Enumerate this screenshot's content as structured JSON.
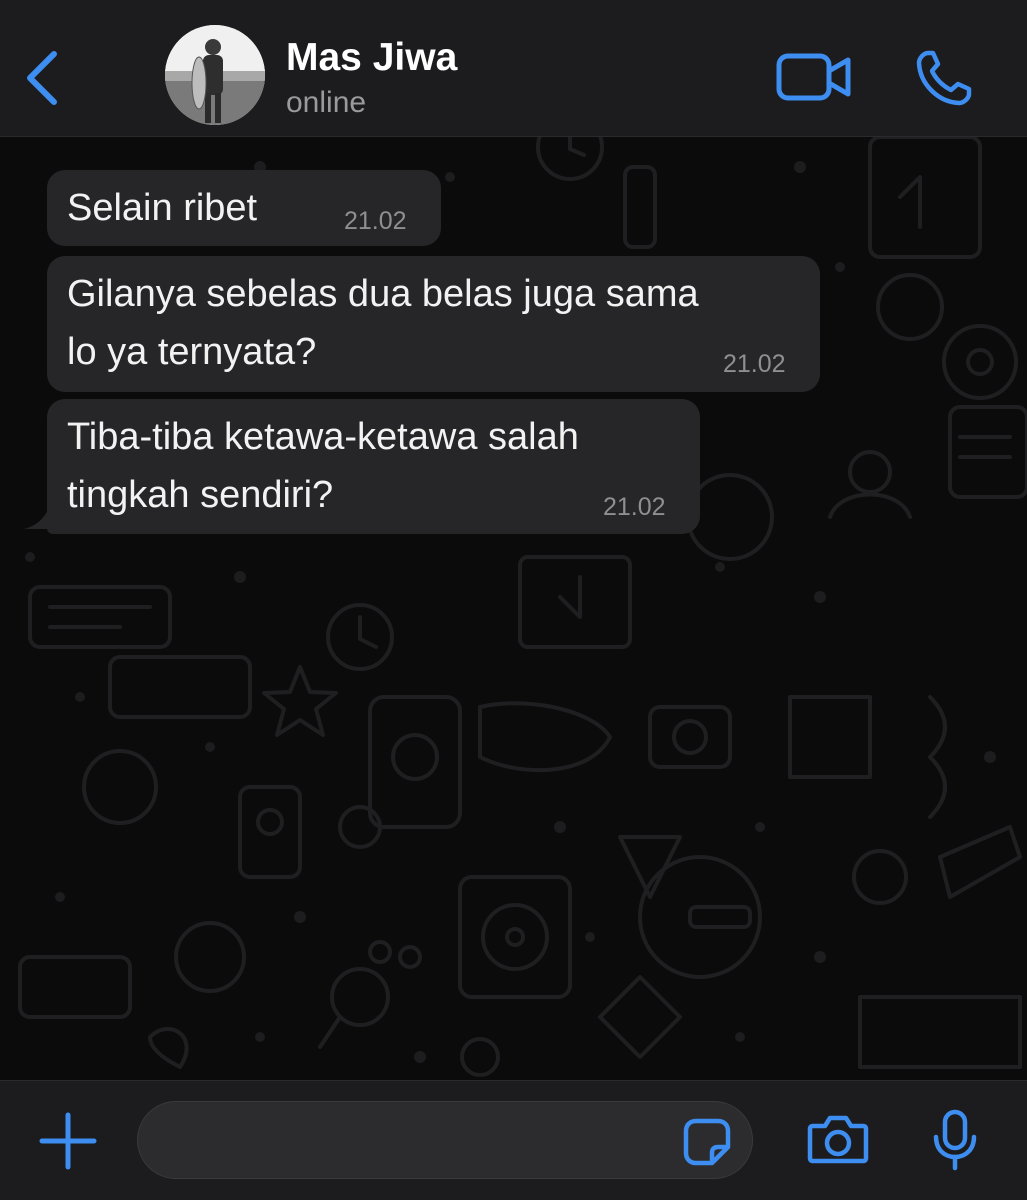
{
  "header": {
    "contact_name": "Mas Jiwa",
    "status": "online"
  },
  "messages": [
    {
      "text": "Selain ribet",
      "time": "21.02"
    },
    {
      "text_line1": "Gilanya sebelas dua belas juga sama",
      "text_line2": "lo ya ternyata?",
      "time": "21.02"
    },
    {
      "text_line1": "Tiba-tiba ketawa-ketawa salah",
      "text_line2": "tingkah sendiri?",
      "time": "21.02"
    }
  ],
  "composer": {
    "value": ""
  },
  "icons": {
    "back": "chevron-left-icon",
    "video": "video-camera-icon",
    "call": "phone-icon",
    "plus": "plus-icon",
    "sticker": "sticker-icon",
    "camera": "camera-icon",
    "mic": "microphone-icon"
  },
  "colors": {
    "accent": "#3d8ef0",
    "bubble": "#262628",
    "bar": "#1c1c1e"
  }
}
